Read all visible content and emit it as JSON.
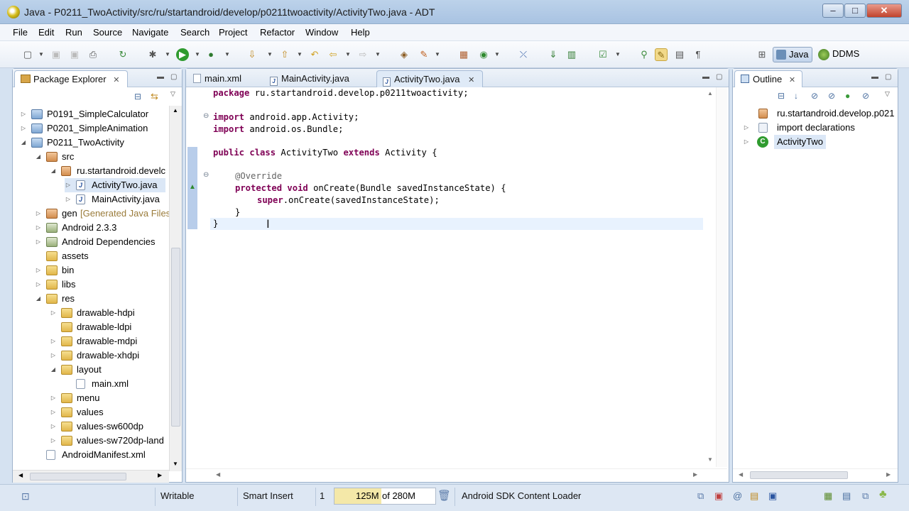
{
  "window": {
    "title": "Java - P0211_TwoActivity/src/ru/startandroid/develop/p0211twoactivity/ActivityTwo.java - ADT"
  },
  "menu": [
    "File",
    "Edit",
    "Run",
    "Source",
    "Navigate",
    "Search",
    "Project",
    "Refactor",
    "Window",
    "Help"
  ],
  "perspectives": {
    "java": "Java",
    "ddms": "DDMS"
  },
  "package_explorer": {
    "title": "Package Explorer",
    "items": [
      {
        "label": "P0191_SimpleCalculator"
      },
      {
        "label": "P0201_SimpleAnimation"
      },
      {
        "label": "P0211_TwoActivity"
      },
      {
        "label": "src"
      },
      {
        "label": "ru.startandroid.develc"
      },
      {
        "label": "ActivityTwo.java"
      },
      {
        "label": "MainActivity.java"
      },
      {
        "label": "gen",
        "note": "[Generated Java Files"
      },
      {
        "label": "Android 2.3.3"
      },
      {
        "label": "Android Dependencies"
      },
      {
        "label": "assets"
      },
      {
        "label": "bin"
      },
      {
        "label": "libs"
      },
      {
        "label": "res"
      },
      {
        "label": "drawable-hdpi"
      },
      {
        "label": "drawable-ldpi"
      },
      {
        "label": "drawable-mdpi"
      },
      {
        "label": "drawable-xhdpi"
      },
      {
        "label": "layout"
      },
      {
        "label": "main.xml"
      },
      {
        "label": "menu"
      },
      {
        "label": "values"
      },
      {
        "label": "values-sw600dp"
      },
      {
        "label": "values-sw720dp-land"
      },
      {
        "label": "AndroidManifest.xml"
      }
    ]
  },
  "editor": {
    "tabs": [
      {
        "label": "main.xml"
      },
      {
        "label": "MainActivity.java"
      },
      {
        "label": "ActivityTwo.java"
      }
    ],
    "code": {
      "l1_kw": "package",
      "l1_rest": " ru.startandroid.develop.p0211twoactivity;",
      "l2_kw": "import",
      "l2_rest": " android.app.Activity;",
      "l3_kw": "import",
      "l3_rest": " android.os.Bundle;",
      "l4_kw1": "public",
      "l4_kw2": "class",
      "l4_mid": " ActivityTwo ",
      "l4_kw3": "extends",
      "l4_rest": " Activity {",
      "l5_ann": "@Override",
      "l6_kw1": "protected",
      "l6_kw2": "void",
      "l6_rest": " onCreate(Bundle savedInstanceState) {",
      "l7_kw": "super",
      "l7_rest": ".onCreate(savedInstanceState);",
      "l8": "}",
      "l9": "}"
    }
  },
  "outline": {
    "title": "Outline",
    "items": [
      {
        "label": "ru.startandroid.develop.p021"
      },
      {
        "label": "import declarations"
      },
      {
        "label": "ActivityTwo"
      }
    ]
  },
  "status": {
    "writable": "Writable",
    "insert_mode": "Smart Insert",
    "line": "1",
    "heap_used": "125M",
    "heap_total": "of 280M",
    "task": "Android SDK Content Loader"
  }
}
